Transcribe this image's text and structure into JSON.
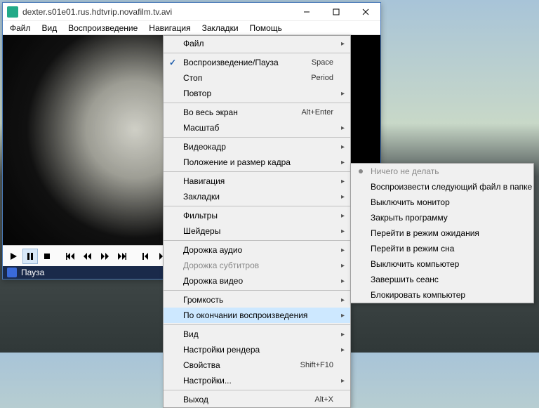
{
  "window": {
    "title": "dexter.s01e01.rus.hdtvrip.novafilm.tv.avi"
  },
  "menubar": [
    "Файл",
    "Вид",
    "Воспроизведение",
    "Навигация",
    "Закладки",
    "Помощь"
  ],
  "status": {
    "label": "Пауза"
  },
  "menu": {
    "items": [
      {
        "label": "Файл",
        "arrow": true
      },
      {
        "sep": true
      },
      {
        "label": "Воспроизведение/Пауза",
        "shortcut": "Space",
        "check": true
      },
      {
        "label": "Стоп",
        "shortcut": "Period"
      },
      {
        "label": "Повтор",
        "arrow": true
      },
      {
        "sep": true
      },
      {
        "label": "Во весь экран",
        "shortcut": "Alt+Enter"
      },
      {
        "label": "Масштаб",
        "arrow": true
      },
      {
        "sep": true
      },
      {
        "label": "Видеокадр",
        "arrow": true
      },
      {
        "label": "Положение и размер кадра",
        "arrow": true
      },
      {
        "sep": true
      },
      {
        "label": "Навигация",
        "arrow": true
      },
      {
        "label": "Закладки",
        "arrow": true
      },
      {
        "sep": true
      },
      {
        "label": "Фильтры",
        "arrow": true
      },
      {
        "label": "Шейдеры",
        "arrow": true
      },
      {
        "sep": true
      },
      {
        "label": "Дорожка аудио",
        "arrow": true
      },
      {
        "label": "Дорожка субтитров",
        "arrow": true,
        "disabled": true
      },
      {
        "label": "Дорожка видео",
        "arrow": true
      },
      {
        "sep": true
      },
      {
        "label": "Громкость",
        "arrow": true
      },
      {
        "label": "По окончании воспроизведения",
        "arrow": true,
        "selected": true
      },
      {
        "sep": true
      },
      {
        "label": "Вид",
        "arrow": true
      },
      {
        "label": "Настройки рендера",
        "arrow": true
      },
      {
        "label": "Свойства",
        "shortcut": "Shift+F10"
      },
      {
        "label": "Настройки...",
        "arrow": true
      },
      {
        "sep": true
      },
      {
        "label": "Выход",
        "shortcut": "Alt+X"
      }
    ]
  },
  "submenu": {
    "items": [
      {
        "label": "Ничего не делать",
        "disabled": true,
        "radio": true
      },
      {
        "label": "Воспроизвести следующий файл в папке"
      },
      {
        "label": "Выключить монитор"
      },
      {
        "label": "Закрыть программу"
      },
      {
        "label": "Перейти в режим ожидания"
      },
      {
        "label": "Перейти в режим сна"
      },
      {
        "label": "Выключить компьютер"
      },
      {
        "label": "Завершить сеанс"
      },
      {
        "label": "Блокировать компьютер"
      }
    ]
  }
}
